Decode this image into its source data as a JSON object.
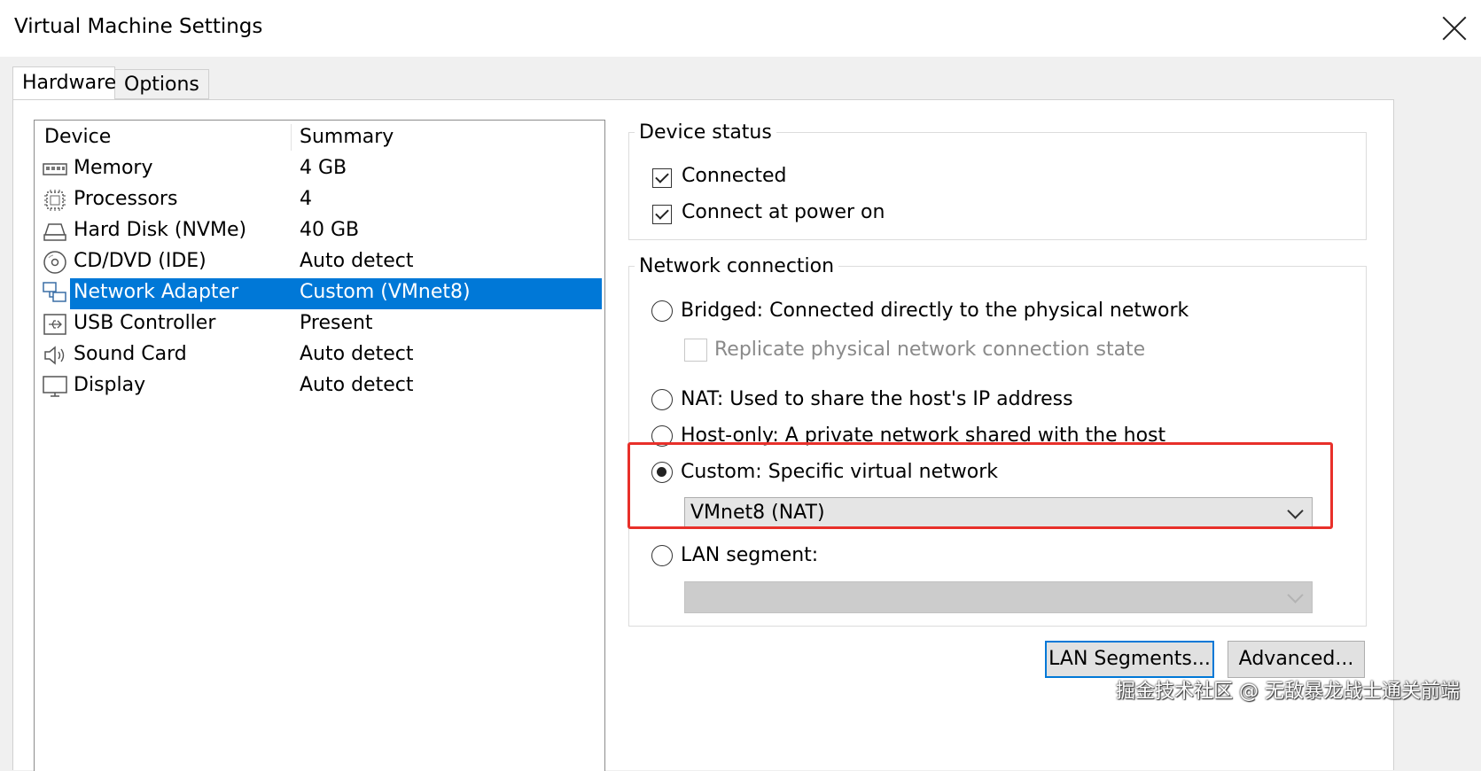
{
  "window": {
    "title": "Virtual Machine Settings"
  },
  "tabs": [
    {
      "label": "Hardware"
    },
    {
      "label": "Options"
    }
  ],
  "device_list": {
    "col_device": "Device",
    "col_summary": "Summary",
    "rows": [
      {
        "name": "Memory",
        "summary": "4 GB",
        "icon": "memory-icon"
      },
      {
        "name": "Processors",
        "summary": "4",
        "icon": "processor-icon"
      },
      {
        "name": "Hard Disk (NVMe)",
        "summary": "40 GB",
        "icon": "hard-disk-icon"
      },
      {
        "name": "CD/DVD (IDE)",
        "summary": "Auto detect",
        "icon": "cd-dvd-icon"
      },
      {
        "name": "Network Adapter",
        "summary": "Custom (VMnet8)",
        "icon": "network-adapter-icon",
        "selected": true
      },
      {
        "name": "USB Controller",
        "summary": "Present",
        "icon": "usb-icon"
      },
      {
        "name": "Sound Card",
        "summary": "Auto detect",
        "icon": "speaker-icon"
      },
      {
        "name": "Display",
        "summary": "Auto detect",
        "icon": "monitor-icon"
      }
    ]
  },
  "device_status": {
    "legend": "Device status",
    "connected_label": "Connected",
    "connected_checked": true,
    "power_on_label": "Connect at power on",
    "power_on_checked": true
  },
  "network_connection": {
    "legend": "Network connection",
    "bridged_label": "Bridged: Connected directly to the physical network",
    "replicate_label": "Replicate physical network connection state",
    "nat_label": "NAT: Used to share the host's IP address",
    "hostonly_label": "Host-only: A private network shared with the host",
    "custom_label": "Custom: Specific virtual network",
    "custom_value": "VMnet8 (NAT)",
    "lan_label": "LAN segment:",
    "lan_value": "",
    "selected": "custom"
  },
  "buttons": {
    "lan_segments": "LAN Segments...",
    "advanced": "Advanced..."
  },
  "watermark": "掘金技术社区 @ 无敌暴龙战士通关前端",
  "colors": {
    "selection": "#0078d7",
    "highlight_box": "#e8302a"
  }
}
